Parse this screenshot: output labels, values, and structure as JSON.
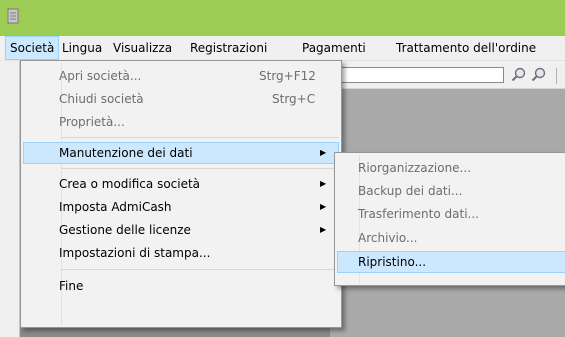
{
  "window": {
    "app_icon": "app-icon"
  },
  "menubar": {
    "items": [
      {
        "label": "Società",
        "active": true
      },
      {
        "label": "Lingua"
      },
      {
        "label": "Visualizza"
      },
      {
        "label": "Registrazioni"
      },
      {
        "label": "Pagamenti"
      },
      {
        "label": "Trattamento dell'ordine"
      }
    ]
  },
  "toolbar": {
    "icons": [
      "zoom-in-icon",
      "zoom-out-icon"
    ]
  },
  "main_menu": {
    "items": [
      {
        "label": "Apri società...",
        "shortcut": "Strg+F12",
        "disabled": true
      },
      {
        "label": "Chiudi società",
        "shortcut": "Strg+C",
        "disabled": true
      },
      {
        "label": "Proprietà...",
        "disabled": true
      },
      {
        "label": "Manutenzione dei dati",
        "submenu": true,
        "highlighted": true
      },
      {
        "label": "Crea o modifica società",
        "submenu": true
      },
      {
        "label": "Imposta AdmiCash",
        "submenu": true
      },
      {
        "label": "Gestione delle licenze",
        "submenu": true
      },
      {
        "label": "Impostazioni di stampa..."
      },
      {
        "label": "Fine"
      }
    ]
  },
  "sub_menu": {
    "items": [
      {
        "label": "Riorganizzazione...",
        "disabled": true
      },
      {
        "label": "Backup dei dati...",
        "disabled": true
      },
      {
        "label": "Trasferimento dati...",
        "disabled": true
      },
      {
        "label": "Archivio...",
        "disabled": true
      },
      {
        "label": "Ripristino...",
        "highlighted": true
      }
    ]
  },
  "colors": {
    "titlebar": "#9dcc55",
    "highlight": "#cce8ff",
    "highlight_border": "#99d1ff"
  }
}
